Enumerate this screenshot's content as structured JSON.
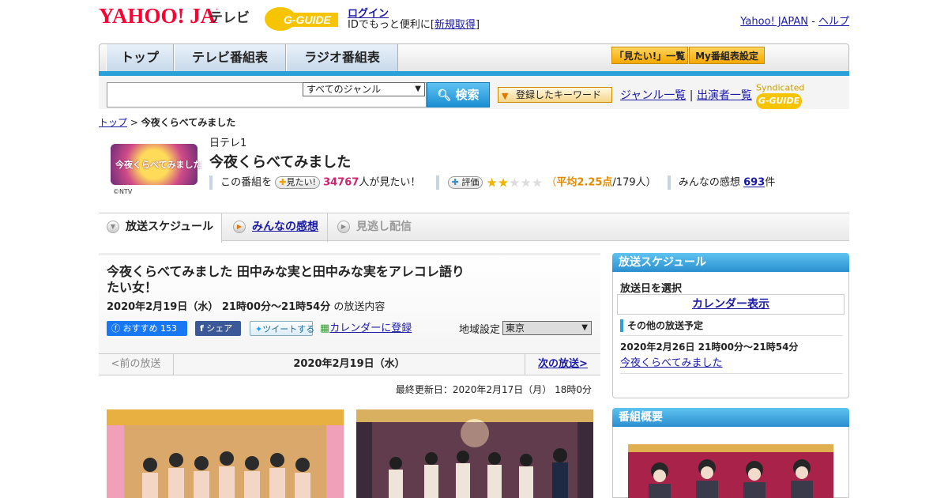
{
  "header": {
    "logo_text": "YAHOO! JAPAN",
    "tv_label": "テレビ",
    "gguide_logo": "G-GUIDE",
    "login_link": "ログイン",
    "id_text": "IDでもっと便利に[",
    "register_link": "新規取得",
    "id_close": "]",
    "yj_link": "Yahoo! JAPAN",
    "sep": "-",
    "help_link": "ヘルプ"
  },
  "nav": {
    "tabs": [
      "トップ",
      "テレビ番組表",
      "ラジオ番組表"
    ],
    "btn_mitai": "「見たい!」一覧",
    "btn_myprog": "My番組表設定"
  },
  "search": {
    "placeholder": "",
    "genre": "すべてのジャンル",
    "button": "検索",
    "kw_button": "登録したキーワード",
    "genre_list": "ジャンル一覧",
    "divider": "|",
    "cast_list": "出演者一覧",
    "syndicated": "Syndicated"
  },
  "breadcrumb": {
    "top": "トップ",
    "sep": " > ",
    "current": "今夜くらべてみました"
  },
  "program": {
    "thumb_text": "今夜くらべてみました",
    "copyright": "©NTV",
    "channel": "日テレ1",
    "title": "今夜くらべてみました",
    "this_prog": "この番組を",
    "mitai_btn": "見たい!",
    "mitai_count": "34767",
    "mitai_suffix": "人が見たい！",
    "rate_btn": "評価",
    "rating_open": "（",
    "rating_avg": "平均2.25点",
    "rating_count": "/179人）",
    "rating_value": 2.25,
    "impressions_label": "みんなの感想",
    "impressions_count": "693",
    "impressions_suffix": "件"
  },
  "tabs": {
    "schedule": "放送スケジュール",
    "reviews": "みんなの感想",
    "vod": "見逃し配信"
  },
  "episode": {
    "title": "今夜くらべてみました 田中みな実と田中みな実をアレコレ語りたい女！",
    "datetime": "2020年2月19日（水） 21時00分～21時54分",
    "suffix": "の放送内容",
    "fb_label": "おすすめ",
    "fb_count": "153",
    "share": "シェア",
    "tweet": "ツイートする",
    "calendar": "カレンダーに登録",
    "region_label": "地域設定",
    "region": "東京"
  },
  "pager": {
    "prev": "<前の放送",
    "current": "2020年2月19日（水）",
    "next": "次の放送>"
  },
  "updated": "最終更新日：2020年2月17日（月） 18時0分",
  "sidebar": {
    "schedule_header": "放送スケジュール",
    "select_date": "放送日を選択",
    "calendar_link": "カレンダー表示",
    "other_header": "その他の放送予定",
    "other_datetime": "2020年2月26日 21時00分～21時54分",
    "other_title": "今夜くらべてみました",
    "overview_header": "番組概要"
  },
  "colors": {
    "accent_blue": "#2aa0d8",
    "yahoo_red": "#ff0033",
    "gguide_yellow": "#f6c400",
    "pink": "#d0246e",
    "rating_orange": "#e08a00"
  }
}
